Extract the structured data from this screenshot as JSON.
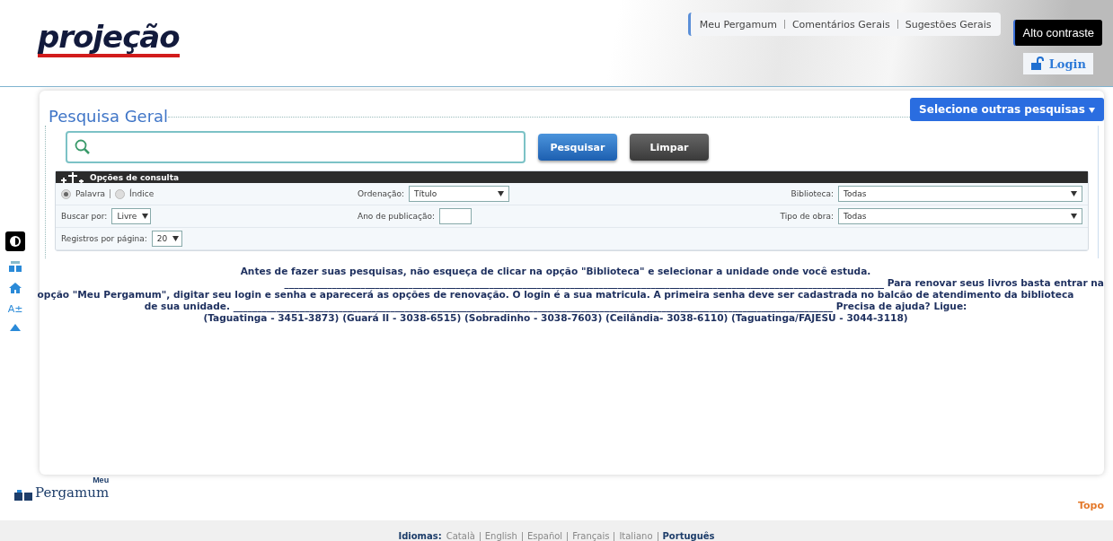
{
  "header": {
    "logo": "projeção",
    "links": [
      "Meu Pergamum",
      "Comentários Gerais",
      "Sugestões Gerais"
    ],
    "contrast_button": "Alto contraste",
    "login": "Login"
  },
  "side_toolbar": {
    "items": [
      {
        "kind": "contrast"
      },
      {
        "kind": "meu"
      },
      {
        "kind": "home"
      },
      {
        "kind": "font",
        "label": "A±"
      },
      {
        "kind": "up"
      }
    ]
  },
  "search": {
    "title": "Pesquisa Geral",
    "other_searches": "Selecione outras pesquisas",
    "search_button": "Pesquisar",
    "clear_button": "Limpar",
    "options": {
      "title": "Opções de consulta",
      "modes": [
        {
          "label": "Palavra",
          "selected": true
        },
        {
          "label": "Índice",
          "selected": false
        }
      ],
      "fields": [
        {
          "label": "Ordenação:",
          "value": "Título",
          "kind": "select"
        },
        {
          "label": "Biblioteca:",
          "value": "Todas",
          "kind": "select"
        },
        {
          "label": "Buscar por:",
          "value": "Livre",
          "kind": "select"
        },
        {
          "label": "Ano de publicação:",
          "kind": "input"
        },
        {
          "label": "Tipo de obra:",
          "value": "Todas",
          "kind": "select"
        },
        {
          "label": "Registros por página:",
          "value": "20",
          "kind": "select"
        }
      ]
    }
  },
  "notice_lines": [
    "Antes de fazer suas pesquisas, não esqueça de clicar na opção \"Biblioteca\" e selecionar a unidade onde você estuda.",
    "______________________________________________________________________________________________________________________________ Para renovar seus livros basta entrar na",
    "opção \"Meu Pergamum\", digitar seu login e senha e aparecerá as opções de renovação. O login é a sua matricula. A primeira senha deve ser cadastrada no balcão de atendimento da biblioteca",
    "de sua unidade. ______________________________________________________________________________________________________________________________ Precisa de ajuda? Ligue:",
    "(Taguatinga - 3451-3873) (Guará II - 3038-6515) (Sobradinho - 3038-7603) (Ceilândia- 3038-6110) (Taguatinga/FAJESU - 3044-3118)"
  ],
  "footer": {
    "logo_top": "Meu",
    "logo_main": "Pergamum",
    "top_link": "Topo",
    "languages_label": "Idiomas:",
    "languages": [
      {
        "label": "Català",
        "selected": false
      },
      {
        "label": "English",
        "selected": false
      },
      {
        "label": "Español",
        "selected": false
      },
      {
        "label": "Français",
        "selected": false
      },
      {
        "label": "Italiano",
        "selected": false
      },
      {
        "label": "Português",
        "selected": true
      }
    ]
  }
}
